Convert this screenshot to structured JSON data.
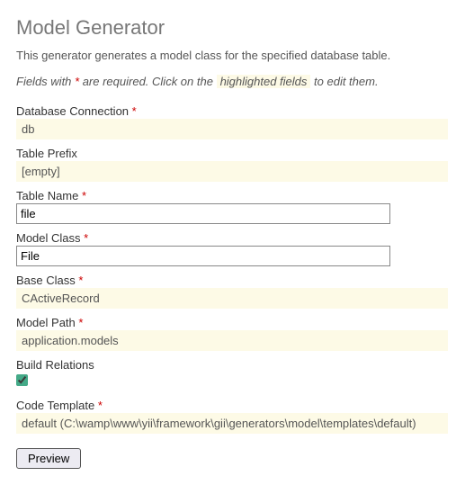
{
  "title": "Model Generator",
  "description": "This generator generates a model class for the specified database table.",
  "hint_prefix": "Fields with ",
  "hint_mid": " are required. Click on the ",
  "hint_highlight": "highlighted fields",
  "hint_suffix": " to edit them.",
  "asterisk": "*",
  "fields": {
    "db_conn_label": "Database Connection ",
    "db_conn_value": "db",
    "table_prefix_label": "Table Prefix",
    "table_prefix_value": "[empty]",
    "table_name_label": "Table Name ",
    "table_name_value": "file",
    "model_class_label": "Model Class ",
    "model_class_value": "File",
    "base_class_label": "Base Class ",
    "base_class_value": "CActiveRecord",
    "model_path_label": "Model Path ",
    "model_path_value": "application.models",
    "build_rel_label": "Build Relations",
    "code_tmpl_label": "Code Template ",
    "code_tmpl_value": "default (C:\\wamp\\www\\yii\\framework\\gii\\generators\\model\\templates\\default)"
  },
  "preview_label": "Preview"
}
